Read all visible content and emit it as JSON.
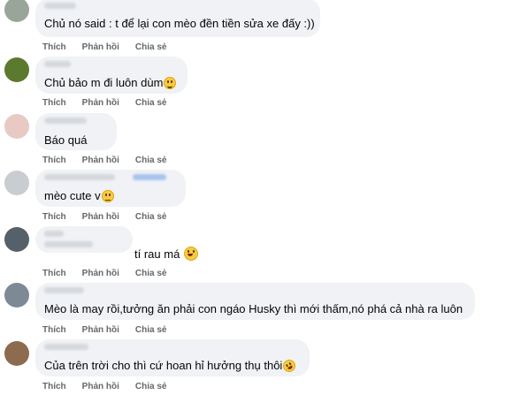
{
  "actions": {
    "like": "Thích",
    "reply": "Phản hồi",
    "share": "Chia sẻ"
  },
  "comments": [
    {
      "text": "Chủ nó said : t để lại con mèo đền tiền sửa xe đấy :))",
      "emoji": ""
    },
    {
      "text": "Chủ bảo m đi luôn dùm",
      "emoji": "grinning-sweat-emoji"
    },
    {
      "text": "Báo quá",
      "emoji": ""
    },
    {
      "text": "mèo cute v",
      "emoji": "unamused-emoji"
    },
    {
      "text": "tí rau má",
      "emoji": "laughing-emoji"
    },
    {
      "text": "Mèo là may rồi,tưởng ăn phải con ngáo Husky thì mới thấm,nó phá cả nhà ra luôn",
      "emoji": ""
    },
    {
      "text": "Của trên trời cho thì cứ hoan hỉ hưởng thụ thôi",
      "emoji": "rofl-emoji"
    }
  ]
}
